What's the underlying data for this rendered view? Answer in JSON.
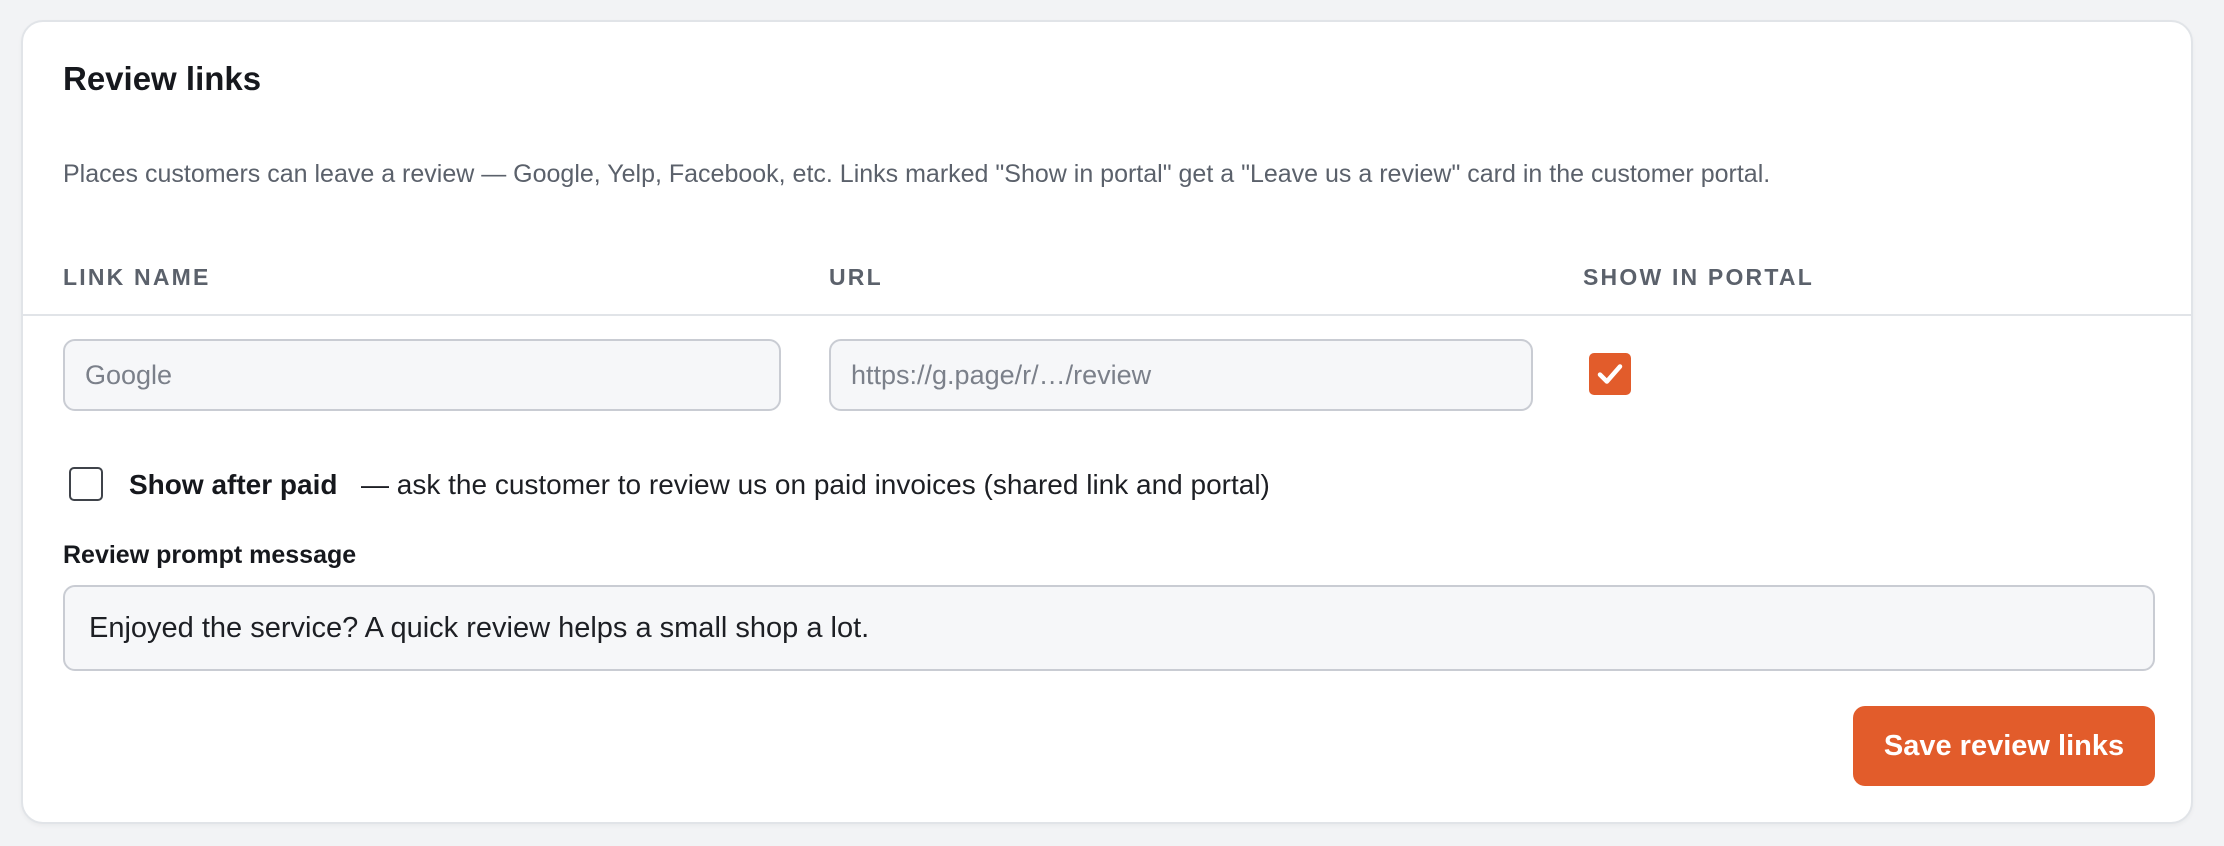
{
  "section": {
    "title": "Review links",
    "description": "Places customers can leave a review — Google, Yelp, Facebook, etc. Links marked \"Show in portal\" get a \"Leave us a review\" card in the customer portal."
  },
  "table": {
    "columns": [
      "LINK NAME",
      "URL",
      "SHOW IN PORTAL"
    ],
    "rows": [
      {
        "name_value": "",
        "name_placeholder": "Google",
        "url_value": "",
        "url_placeholder": "https://g.page/r/…/review",
        "show_in_portal": true
      }
    ]
  },
  "show_after_paid": {
    "checked": false,
    "label": "Show after paid",
    "description": "— ask the customer to review us on paid invoices (shared link and portal)"
  },
  "review_prompt": {
    "label": "Review prompt message",
    "value": "Enjoyed the service? A quick review helps a small shop a lot."
  },
  "actions": {
    "save_label": "Save review links"
  },
  "colors": {
    "accent": "#e25c2b",
    "card_background": "#ffffff",
    "page_background": "#f2f3f5",
    "muted_text": "#5b616b"
  },
  "icons": {
    "portal_checkbox": "check-icon"
  }
}
